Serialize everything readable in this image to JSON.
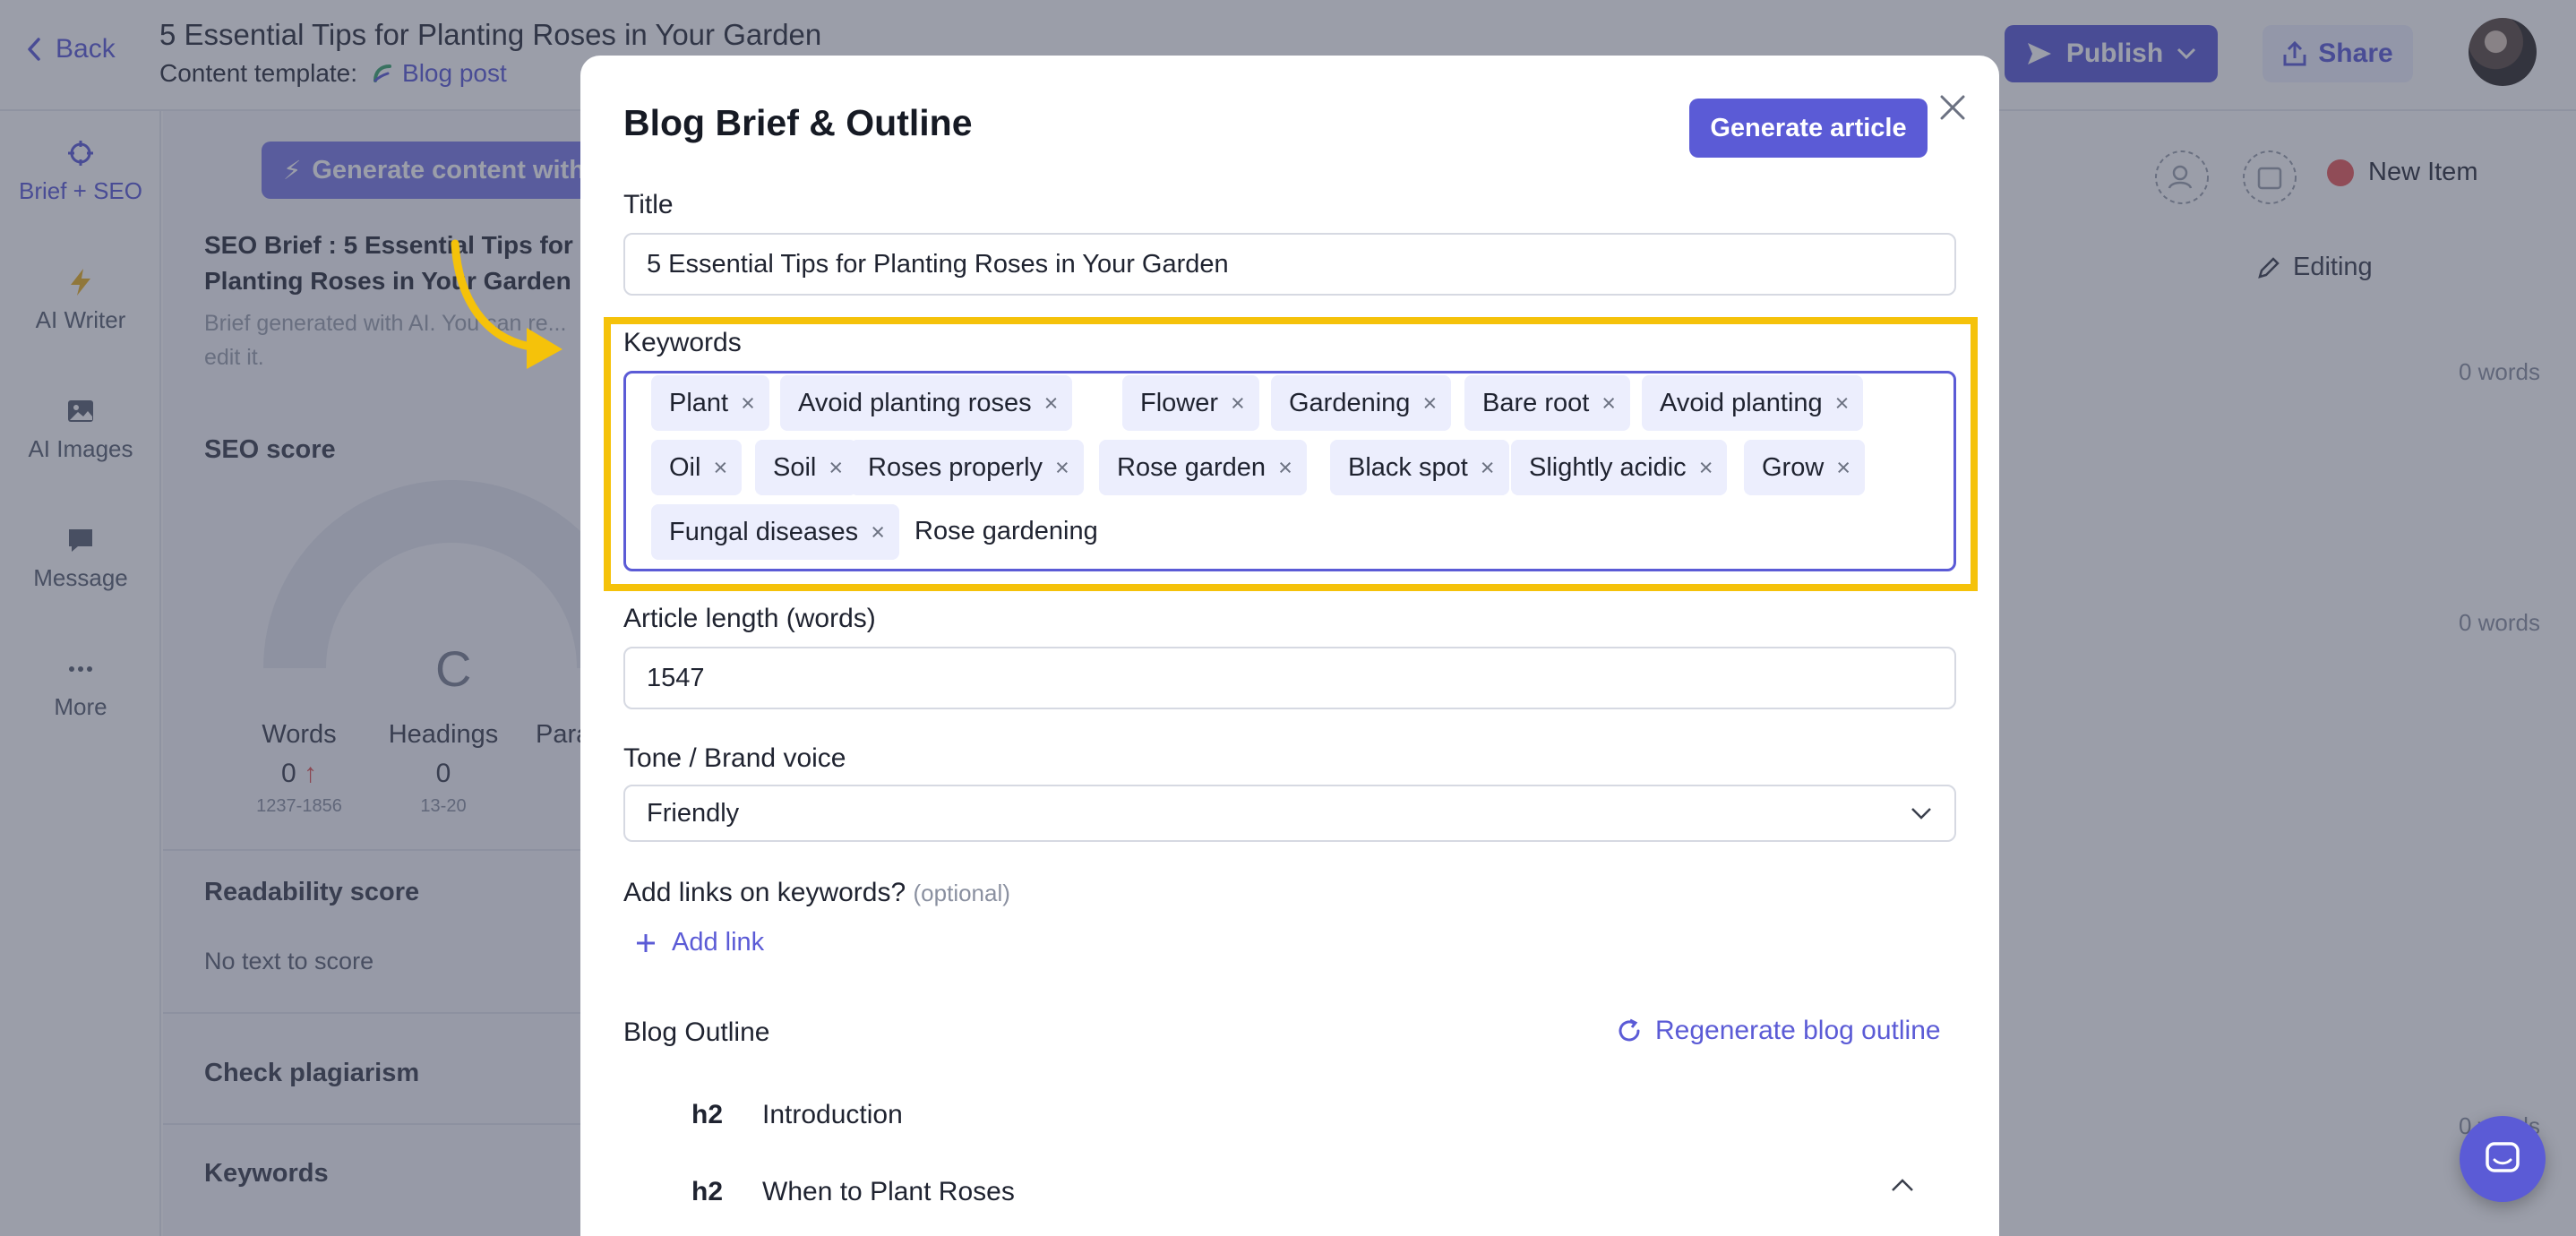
{
  "header": {
    "back_label": "Back",
    "doc_title": "5 Essential Tips for Planting Roses in Your Garden",
    "template_label": "Content template:",
    "template_name": "Blog post",
    "publish_label": "Publish",
    "share_label": "Share"
  },
  "leftnav": {
    "items": [
      {
        "label": "Brief + SEO",
        "icon": "crosshair-icon"
      },
      {
        "label": "AI Writer",
        "icon": "lightning-icon"
      },
      {
        "label": "AI Images",
        "icon": "image-icon"
      },
      {
        "label": "Message",
        "icon": "chat-icon"
      },
      {
        "label": "More",
        "icon": "ellipsis-icon"
      }
    ]
  },
  "brief_panel": {
    "generate_label": "Generate content with",
    "seo_brief_title": "SEO Brief : 5 Essential Tips for Planting Roses in Your Garden",
    "brief_note": "Brief generated with AI. You can re... edit it.",
    "seo_score_label": "SEO score",
    "grade": "C",
    "stats": [
      {
        "label": "Words",
        "value": "0",
        "range": "1237-1856"
      },
      {
        "label": "Headings",
        "value": "0",
        "range": "13-20"
      },
      {
        "label": "Para",
        "value": "",
        "range": ""
      }
    ],
    "readability_label": "Readability score",
    "readability_text": "No text to score",
    "plagiarism_label": "Check plagiarism",
    "keywords_label": "Keywords"
  },
  "editor": {
    "new_item_label": "New Item",
    "editing_label": "Editing",
    "word_counts": [
      "0 words",
      "0 words",
      "0 words"
    ]
  },
  "modal": {
    "title": "Blog Brief & Outline",
    "generate_article_label": "Generate article",
    "title_field_label": "Title",
    "title_value": "5 Essential Tips for Planting Roses in Your Garden",
    "keywords_label": "Keywords",
    "keywords": [
      "Plant",
      "Avoid planting roses",
      "Flower",
      "Gardening",
      "Bare root",
      "Avoid planting",
      "Oil",
      "Soil",
      "Roses properly",
      "Rose garden",
      "Black spot",
      "Slightly acidic",
      "Grow",
      "Fungal diseases"
    ],
    "keyword_typed": "Rose gardening",
    "tag_remove_glyph": "×",
    "length_label": "Article length (words)",
    "length_value": "1547",
    "tone_label": "Tone / Brand voice",
    "tone_value": "Friendly",
    "links_label": "Add links on keywords?",
    "links_optional": "(optional)",
    "add_link_label": "Add link",
    "outline_label": "Blog Outline",
    "regenerate_label": "Regenerate blog outline",
    "outline": [
      {
        "level": "h2",
        "text": "Introduction"
      },
      {
        "level": "h2",
        "text": "When to Plant Roses"
      }
    ]
  },
  "colors": {
    "accent": "#5b5bd6",
    "highlight": "#f5c20a",
    "tag_bg": "#eceefd"
  }
}
